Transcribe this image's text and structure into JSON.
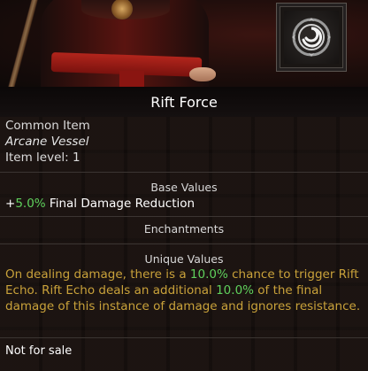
{
  "item": {
    "name": "Rift Force",
    "rarity": "Common Item",
    "type": "Arcane Vessel",
    "level": "Item level: 1"
  },
  "sections": {
    "base_values": "Base Values",
    "enchantments": "Enchantments",
    "unique_values": "Unique Values"
  },
  "base_stat": {
    "sign": "+",
    "value": "5.0%",
    "label": "Final Damage Reduction"
  },
  "unique": {
    "t1": "On dealing damage, there is a ",
    "v1": "10.0%",
    "t2": " chance to trigger Rift Echo. Rift Echo deals an additional ",
    "v2": "10.0%",
    "t3": " of the final damage of this instance of damage and ignores resistance."
  },
  "footer": "Not for sale",
  "colors": {
    "value_green": "#5fd15c",
    "unique_gold": "#c9a23a"
  },
  "icons": [
    "rift-swirl-icon"
  ]
}
